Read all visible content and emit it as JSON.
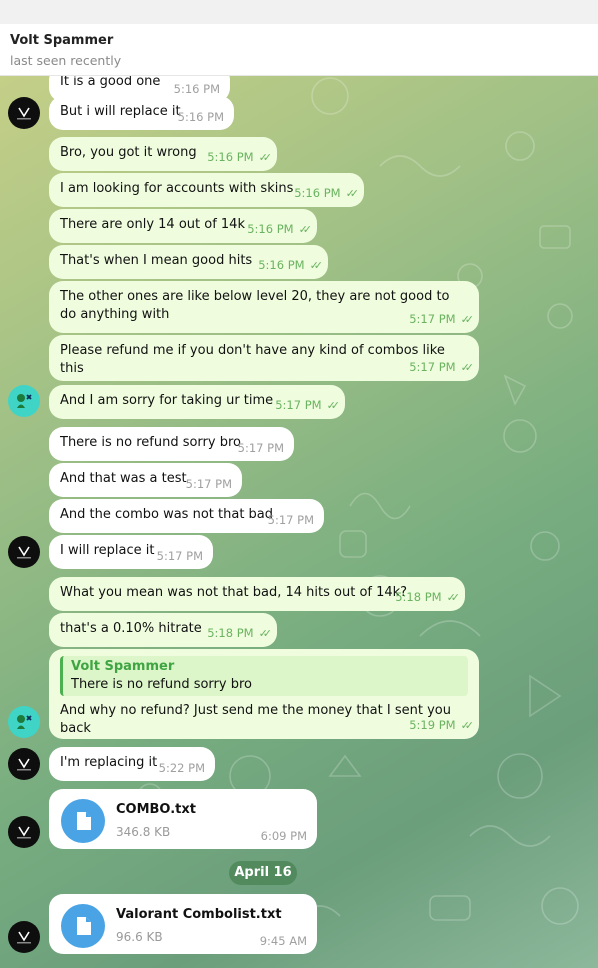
{
  "header": {
    "title": "Volt Spammer",
    "status": "last seen recently"
  },
  "messages": [
    {
      "dir": "in",
      "text": "It is a good one",
      "time": "5:16 PM"
    },
    {
      "dir": "in",
      "text": "But i will replace it",
      "time": "5:16 PM"
    },
    {
      "dir": "out",
      "text": "Bro, you got it wrong",
      "time": "5:16 PM"
    },
    {
      "dir": "out",
      "text": "I am looking for accounts with skins",
      "time": "5:16 PM"
    },
    {
      "dir": "out",
      "text": "There are only 14 out of 14k",
      "time": "5:16 PM"
    },
    {
      "dir": "out",
      "text": "That's when I mean good hits",
      "time": "5:16 PM"
    },
    {
      "dir": "out",
      "text": "The other ones are like below level 20, they are not good to do anything with",
      "time": "5:17 PM"
    },
    {
      "dir": "out",
      "text": "Please refund me if you don't have any kind of combos like this",
      "time": "5:17 PM"
    },
    {
      "dir": "out",
      "text": "And I am sorry for taking ur time",
      "time": "5:17 PM"
    },
    {
      "dir": "in",
      "text": "There is no refund sorry bro",
      "time": "5:17 PM"
    },
    {
      "dir": "in",
      "text": "And that was a test",
      "time": "5:17 PM"
    },
    {
      "dir": "in",
      "text": "And the combo was not that bad",
      "time": "5:17 PM"
    },
    {
      "dir": "in",
      "text": "I will replace it",
      "time": "5:17 PM"
    },
    {
      "dir": "out",
      "text": "What you mean was not that bad, 14 hits out of 14k?",
      "time": "5:18 PM"
    },
    {
      "dir": "out",
      "text": "that's a 0.10% hitrate",
      "time": "5:18 PM"
    },
    {
      "dir": "out",
      "text": "And why no refund? Just send me the money that I sent you back",
      "time": "5:19 PM",
      "reply": {
        "name": "Volt Spammer",
        "text": "There is no refund sorry bro"
      }
    },
    {
      "dir": "in",
      "text": "I'm replacing it",
      "time": "5:22 PM"
    },
    {
      "dir": "in",
      "file": {
        "name": "COMBO.txt",
        "size": "346.8 KB"
      },
      "time": "6:09 PM"
    },
    {
      "dir": "in",
      "file": {
        "name": "Valorant Combolist.txt",
        "size": "96.6 KB"
      },
      "time": "9:45 AM"
    }
  ],
  "date_separator": "April 16",
  "icons": {
    "read": "double-check-icon",
    "file": "document-icon",
    "avatar_volt": "volt-logo-icon",
    "avatar_user": "user-avatar-icon"
  },
  "colors": {
    "outgoing_bubble": "#effdde",
    "incoming_bubble": "#ffffff",
    "accent_green": "#4cb050",
    "file_blue": "#4aa3e5"
  }
}
